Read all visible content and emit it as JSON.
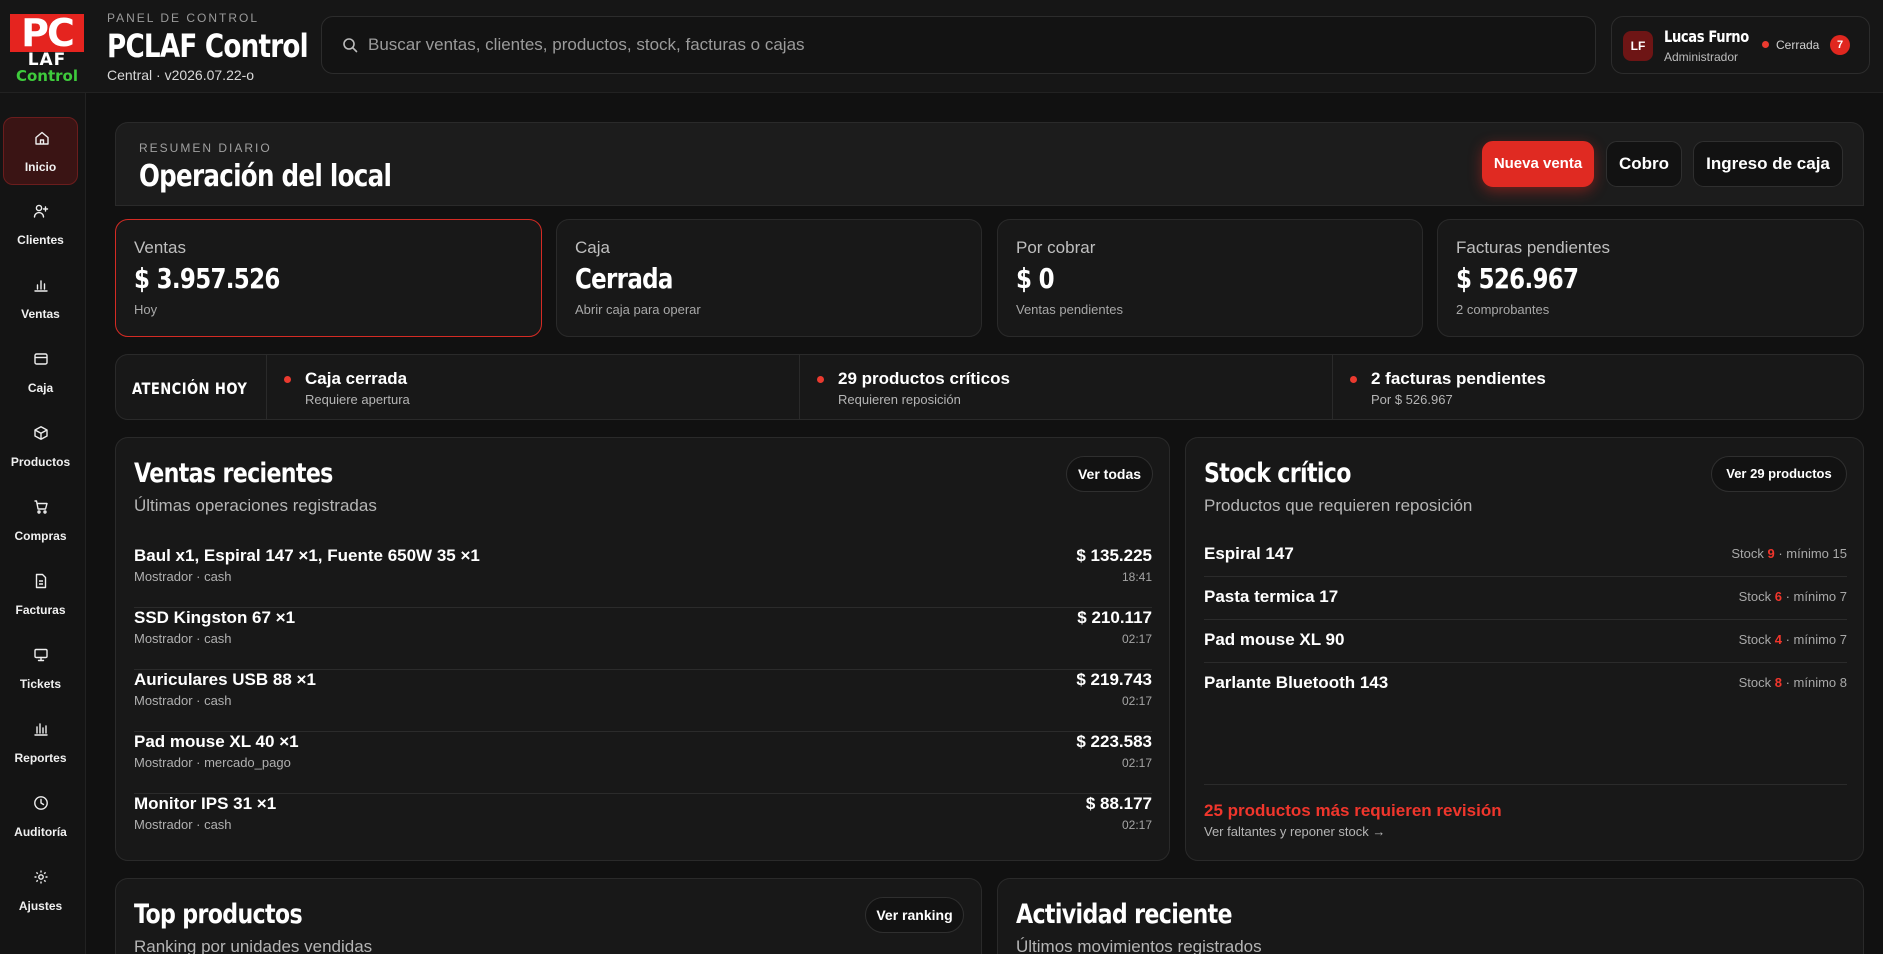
{
  "brand": {
    "logo_pc": "PC",
    "logo_laf": "LAF",
    "logo_control": "Control",
    "kicker": "PANEL DE CONTROL",
    "title": "PCLAF Control",
    "subtitle": "Central · v2026.07.22-o"
  },
  "search": {
    "placeholder": "Buscar ventas, clientes, productos, stock, facturas o cajas",
    "value": ""
  },
  "user": {
    "initials": "LF",
    "name": "Lucas Furno",
    "role": "Administrador",
    "status": "Cerrada",
    "notifications": "7",
    "status_color": "#ea3a2f"
  },
  "sidebar": {
    "items": [
      {
        "label": "Inicio",
        "icon": "home-icon",
        "active": true
      },
      {
        "label": "Clientes",
        "icon": "user-plus-icon"
      },
      {
        "label": "Ventas",
        "icon": "bar-chart-icon"
      },
      {
        "label": "Caja",
        "icon": "cash-register-icon"
      },
      {
        "label": "Productos",
        "icon": "box-icon"
      },
      {
        "label": "Compras",
        "icon": "cart-icon"
      },
      {
        "label": "Facturas",
        "icon": "document-icon"
      },
      {
        "label": "Tickets",
        "icon": "monitor-icon"
      },
      {
        "label": "Reportes",
        "icon": "report-chart-icon"
      },
      {
        "label": "Auditoría",
        "icon": "clock-icon"
      },
      {
        "label": "Ajustes",
        "icon": "gear-icon"
      }
    ]
  },
  "header": {
    "kicker": "RESUMEN DIARIO",
    "title": "Operación del local",
    "new_sale": "Nueva venta",
    "charge": "Cobro",
    "cash_in": "Ingreso de caja"
  },
  "stats": [
    {
      "label": "Ventas",
      "value": "$ 3.957.526",
      "sub": "Hoy"
    },
    {
      "label": "Caja",
      "value": "Cerrada",
      "sub": "Abrir caja para operar"
    },
    {
      "label": "Por cobrar",
      "value": "$ 0",
      "sub": "Ventas pendientes"
    },
    {
      "label": "Facturas pendientes",
      "value": "$ 526.967",
      "sub": "2 comprobantes"
    }
  ],
  "attention": {
    "title": "ATENCIÓN HOY",
    "items": [
      {
        "title": "Caja cerrada",
        "sub": "Requiere apertura"
      },
      {
        "title": "29 productos críticos",
        "sub": "Requieren reposición"
      },
      {
        "title": "2 facturas pendientes",
        "sub": "Por $ 526.967"
      }
    ]
  },
  "recent_sales": {
    "title": "Ventas recientes",
    "subtitle": "Últimas operaciones registradas",
    "view_all": "Ver todas",
    "rows": [
      {
        "name": "Baul x1, Espiral 147 ×1, Fuente 650W 35 ×1",
        "meta": "Mostrador · cash",
        "amount": "$ 135.225",
        "time": "18:41"
      },
      {
        "name": "SSD Kingston 67 ×1",
        "meta": "Mostrador · cash",
        "amount": "$ 210.117",
        "time": "02:17"
      },
      {
        "name": "Auriculares USB 88 ×1",
        "meta": "Mostrador · cash",
        "amount": "$ 219.743",
        "time": "02:17"
      },
      {
        "name": "Pad mouse XL 40 ×1",
        "meta": "Mostrador · mercado_pago",
        "amount": "$ 223.583",
        "time": "02:17"
      },
      {
        "name": "Monitor IPS 31 ×1",
        "meta": "Mostrador · cash",
        "amount": "$ 88.177",
        "time": "02:17"
      }
    ]
  },
  "critical_stock": {
    "title": "Stock crítico",
    "subtitle": "Productos que requieren reposición",
    "view_btn": "Ver 29 productos",
    "stock_label": "Stock",
    "min_label": "· mínimo",
    "rows": [
      {
        "name": "Espiral 147",
        "stock": "9",
        "min": "15"
      },
      {
        "name": "Pasta termica 17",
        "stock": "6",
        "min": "7"
      },
      {
        "name": "Pad mouse XL 90",
        "stock": "4",
        "min": "7"
      },
      {
        "name": "Parlante Bluetooth 143",
        "stock": "8",
        "min": "8"
      }
    ],
    "warning": "25 productos más requieren revisión",
    "link": "Ver faltantes y reponer stock →"
  },
  "top_products": {
    "title": "Top productos",
    "subtitle": "Ranking por unidades vendidas",
    "button": "Ver ranking"
  },
  "activity": {
    "title": "Actividad reciente",
    "subtitle": "Últimos movimientos registrados"
  },
  "colors": {
    "accent": "#e02a22",
    "background": "#111111",
    "card": "#181818"
  }
}
